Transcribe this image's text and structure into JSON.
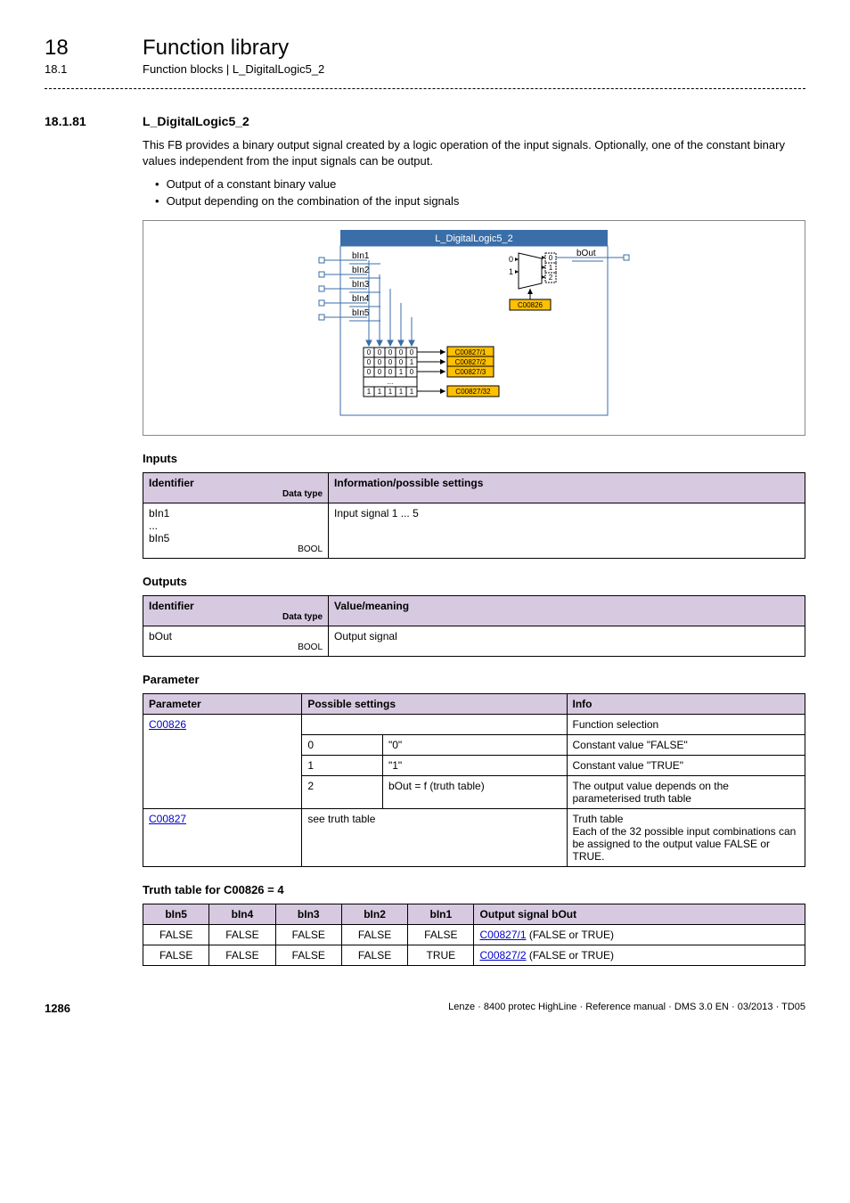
{
  "header": {
    "chapter_num": "18",
    "chapter_title": "Function library",
    "sub_num": "18.1",
    "sub_title": "Function blocks | L_DigitalLogic5_2"
  },
  "section": {
    "num": "18.1.81",
    "title": "L_DigitalLogic5_2",
    "intro": "This FB provides a binary output signal created by a logic operation of the input signals. Optionally, one of the constant binary values independent from the input signals can be output.",
    "bullets": [
      "Output of a constant binary value",
      "Output depending on the combination of the input signals"
    ]
  },
  "diagram": {
    "title": "L_DigitalLogic5_2",
    "inputs": [
      "bIn1",
      "bIn2",
      "bIn3",
      "bIn4",
      "bIn5"
    ],
    "mux_nums": [
      "0",
      "1",
      "2"
    ],
    "mux_in0": "0",
    "mux_in1": "1",
    "out_label": "bOut",
    "sel_code": "C00826",
    "truth_rows": [
      {
        "bits": [
          "0",
          "0",
          "0",
          "0",
          "0"
        ],
        "code": "C00827/1"
      },
      {
        "bits": [
          "0",
          "0",
          "0",
          "0",
          "1"
        ],
        "code": "C00827/2"
      },
      {
        "bits": [
          "0",
          "0",
          "0",
          "1",
          "0"
        ],
        "code": "C00827/3"
      }
    ],
    "truth_ellipsis": "...",
    "truth_last": {
      "bits": [
        "1",
        "1",
        "1",
        "1",
        "1"
      ],
      "code": "C00827/32"
    }
  },
  "inputs_table": {
    "head_id": "Identifier",
    "head_dt": "Data type",
    "head_info": "Information/possible settings",
    "row_id_top": "bIn1",
    "row_id_mid": "...",
    "row_id_bot": "bIn5",
    "row_dt": "BOOL",
    "row_info": "Input signal 1 ... 5"
  },
  "outputs_table": {
    "head_id": "Identifier",
    "head_dt": "Data type",
    "head_vm": "Value/meaning",
    "row_id": "bOut",
    "row_dt": "BOOL",
    "row_vm": "Output signal"
  },
  "param_table": {
    "head_param": "Parameter",
    "head_ps": "Possible settings",
    "head_info": "Info",
    "c826": "C00826",
    "c826_info": "Function selection",
    "r0_n": "0",
    "r0_t": "\"0\"",
    "r0_i": "Constant value \"FALSE\"",
    "r1_n": "1",
    "r1_t": "\"1\"",
    "r1_i": "Constant value \"TRUE\"",
    "r2_n": "2",
    "r2_t": "bOut = f (truth table)",
    "r2_i": "The output value depends on the parameterised truth table",
    "c827": "C00827",
    "c827_ps": "see truth table",
    "c827_i": "Truth table\nEach of the 32 possible input combinations can be assigned to the output value FALSE or TRUE."
  },
  "truth_heading": "Truth table for C00826 = 4",
  "truth_table": {
    "cols": [
      "bIn5",
      "bIn4",
      "bIn3",
      "bIn2",
      "bIn1",
      "Output signal bOut"
    ],
    "rows": [
      {
        "c": [
          "FALSE",
          "FALSE",
          "FALSE",
          "FALSE",
          "FALSE"
        ],
        "link": "C00827/1",
        "tail": " (FALSE or TRUE)"
      },
      {
        "c": [
          "FALSE",
          "FALSE",
          "FALSE",
          "FALSE",
          "TRUE"
        ],
        "link": "C00827/2",
        "tail": " (FALSE or TRUE)"
      }
    ]
  },
  "headings": {
    "inputs": "Inputs",
    "outputs": "Outputs",
    "parameter": "Parameter"
  },
  "footer": {
    "page": "1286",
    "right": "Lenze · 8400 protec HighLine · Reference manual · DMS 3.0 EN · 03/2013 · TD05"
  }
}
